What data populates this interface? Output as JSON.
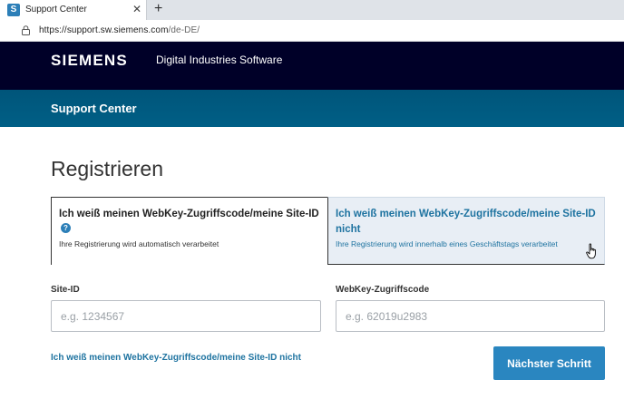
{
  "browser": {
    "tab_title": "Support Center",
    "favicon_letter": "S",
    "url_host": "https://support.sw.siemens.com",
    "url_path": "/de-DE/"
  },
  "header": {
    "logo": "SIEMENS",
    "division": "Digital Industries Software",
    "subtitle": "Support Center"
  },
  "page": {
    "title": "Registrieren",
    "options": {
      "known": {
        "title": "Ich weiß meinen WebKey-Zugriffscode/meine Site-ID",
        "subtitle": "Ihre Registrierung wird automatisch verarbeitet",
        "selected": true
      },
      "unknown": {
        "title": "Ich weiß meinen WebKey-Zugriffscode/meine Site-ID nicht",
        "subtitle": "Ihre Registrierung wird innerhalb eines Geschäftstags verarbeitet",
        "selected": false
      }
    },
    "fields": {
      "site_id": {
        "label": "Site-ID",
        "placeholder": "e.g. 1234567",
        "value": ""
      },
      "webkey": {
        "label": "WebKey-Zugriffscode",
        "placeholder": "e.g. 62019u2983",
        "value": ""
      }
    },
    "link_unknown": "Ich weiß meinen WebKey-Zugriffscode/meine Site-ID nicht",
    "next_button": "Nächster Schritt"
  },
  "colors": {
    "brand_dark": "#000028",
    "brand_petrol": "#005f86",
    "accent": "#2a86c0",
    "link": "#1e73a0"
  }
}
